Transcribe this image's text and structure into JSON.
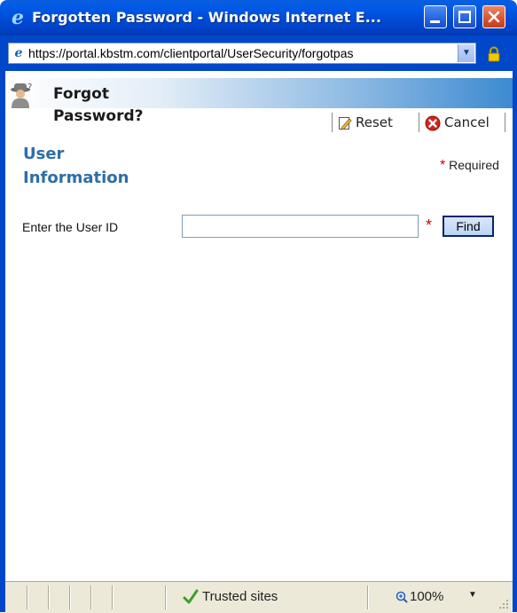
{
  "window": {
    "title": "Forgotten Password - Windows Internet E...",
    "icons": [
      "ie-icon",
      "minimize-icon",
      "maximize-icon",
      "close-icon"
    ]
  },
  "address_bar": {
    "url": "https://portal.kbstm.com/clientportal/UserSecurity/forgotpas",
    "icons": [
      "page-icon",
      "chevron-down-icon",
      "lock-icon"
    ]
  },
  "header": {
    "title": "Forgot Password?",
    "icon": "detective-icon"
  },
  "toolbar": {
    "reset_label": "Reset",
    "cancel_label": "Cancel",
    "reset_icon": "edit-icon",
    "cancel_icon": "cancel-icon"
  },
  "section": {
    "title": "User Information",
    "required_star": "*",
    "required_label": "Required"
  },
  "form": {
    "userid_label": "Enter the User ID",
    "userid_value": "",
    "userid_placeholder": "",
    "required_star": "*",
    "find_label": "Find"
  },
  "status_bar": {
    "zone": "Trusted sites",
    "zoom": "100%",
    "icons": [
      "check-icon",
      "zoom-icon",
      "chevron-down-icon"
    ]
  },
  "colors": {
    "titlebar": "#0058e6",
    "section_title": "#2e6ea6",
    "required": "#d00000"
  }
}
